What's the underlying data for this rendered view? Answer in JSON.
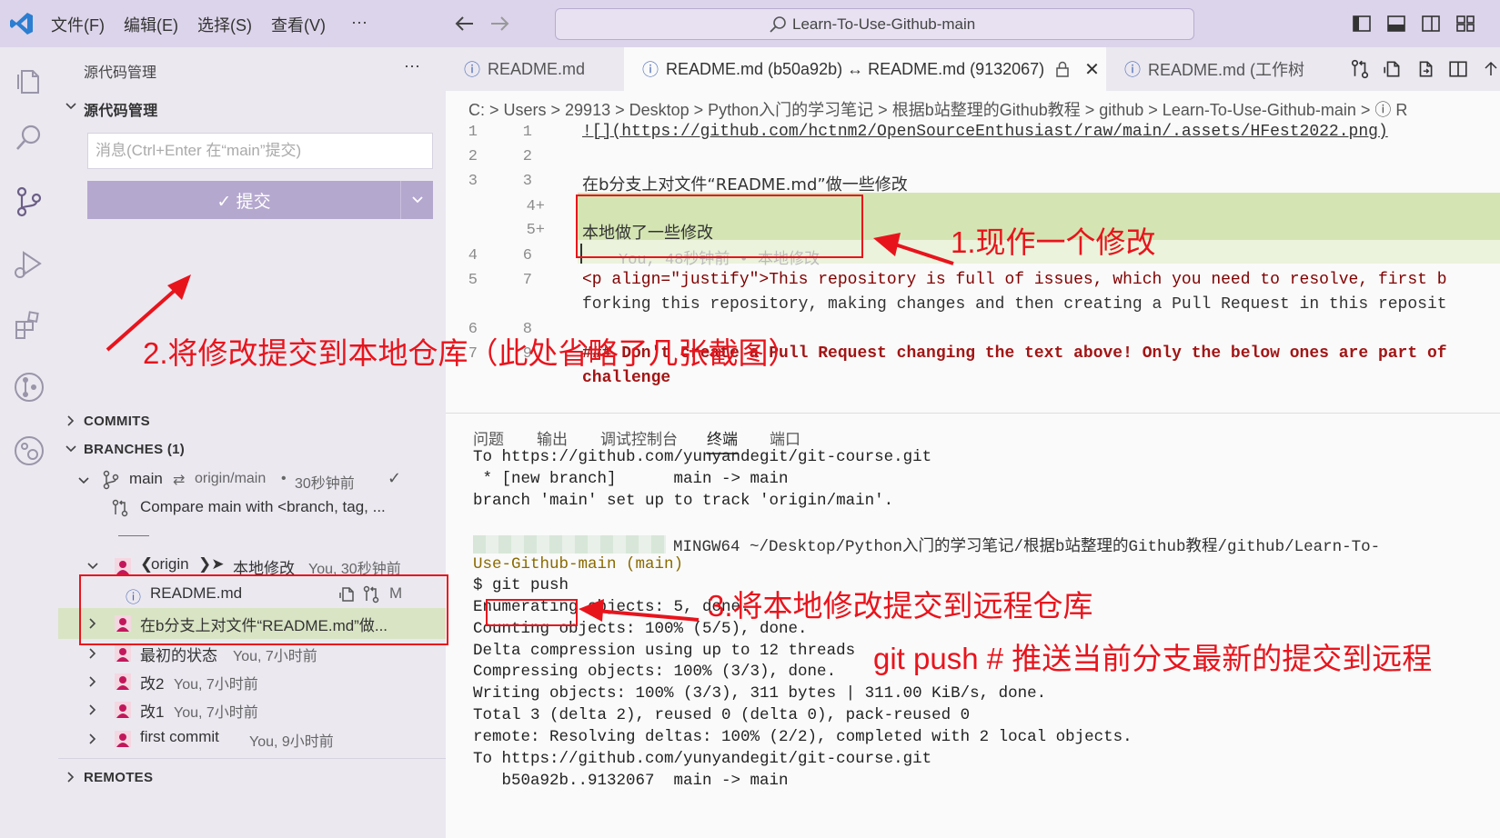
{
  "menu": {
    "file": "文件(F)",
    "edit": "编辑(E)",
    "select": "选择(S)",
    "view": "查看(V)",
    "more": "···"
  },
  "search": {
    "text": "Learn-To-Use-Github-main"
  },
  "sidebar": {
    "title": "源代码管理",
    "more": "···",
    "section": "源代码管理",
    "message_placeholder": "消息(Ctrl+Enter 在“main”提交)",
    "commit_label": "✓ 提交",
    "commits_header": "COMMITS",
    "branches_header": "BRANCHES (1)",
    "branch": {
      "name": "main",
      "remote": "origin/main",
      "time": "30秒钟前"
    },
    "compare": "Compare main with <branch, tag, ...",
    "commits": [
      {
        "message": "本地修改",
        "meta": "You, 30秒钟前",
        "tag": "origin"
      },
      {
        "message": "在b分支上对文件“README.md”做...",
        "meta": ""
      },
      {
        "message": "最初的状态",
        "meta": "You, 7小时前"
      },
      {
        "message": "改2",
        "meta": "You, 7小时前"
      },
      {
        "message": "改1",
        "meta": "You, 7小时前"
      },
      {
        "message": "first commit",
        "meta": "You, 9小时前"
      }
    ],
    "file": {
      "name": "README.md",
      "status": "M"
    },
    "remotes_header": "REMOTES"
  },
  "tabs": [
    {
      "label": "README.md"
    },
    {
      "label": "README.md (b50a92b) ↔ README.md (9132067)"
    },
    {
      "label": "README.md (工作树"
    }
  ],
  "breadcrumb": "C: > Users > 29913 > Desktop > Python入门的学习笔记 > 根据b站整理的Github教程 > github > Learn-To-Use-Github-main > ⓘ R",
  "editor": {
    "lines": [
      {
        "old": "1",
        "new": "1",
        "text": "![](https://github.com/hctnm2/OpenSourceEnthusiast/raw/main/.assets/HFest2022.png)"
      },
      {
        "old": "2",
        "new": "2",
        "text": ""
      },
      {
        "old": "3",
        "new": "3",
        "text": "在b分支上对文件“README.md”做一些修改"
      },
      {
        "old": "",
        "new": "4+",
        "text": ""
      },
      {
        "old": "",
        "new": "5+",
        "text": "本地做了一些修改"
      },
      {
        "old": "4",
        "new": "6",
        "text": ""
      },
      {
        "old": "5",
        "new": "7",
        "text": "<p align=\"justify\">This repository is full of issues, which you need to resolve, first b"
      },
      {
        "old": "",
        "new": "",
        "text": "forking this repository, making changes and then creating a Pull Request in this reposit"
      },
      {
        "old": "6",
        "new": "8",
        "text": ""
      },
      {
        "old": "7",
        "new": "9",
        "text": "### Don't create a Pull Request changing the text above! Only the below ones are part of"
      },
      {
        "old": "",
        "new": "",
        "text": "challenge"
      }
    ],
    "blame": "You, 48秒钟前 • 本地修改"
  },
  "panel": {
    "tabs": [
      "问题",
      "输出",
      "调试控制台",
      "终端",
      "端口"
    ],
    "terminal": [
      "To https://github.com/yunyandegit/git-course.git",
      " * [new branch]      main -> main",
      "branch 'main' set up to track 'origin/main'.",
      "",
      "MINGW64 ~/Desktop/Python入门的学习笔记/根据b站整理的Github教程/github/Learn-To-",
      "Use-Github-main (main)",
      "$ git push",
      "Enumerating objects: 5, done.",
      "Counting objects: 100% (5/5), done.",
      "Delta compression using up to 12 threads",
      "Compressing objects: 100% (3/3), done.",
      "Writing objects: 100% (3/3), 311 bytes | 311.00 KiB/s, done.",
      "Total 3 (delta 2), reused 0 (delta 0), pack-reused 0",
      "remote: Resolving deltas: 100% (2/2), completed with 2 local objects.",
      "To https://github.com/yunyandegit/git-course.git",
      "   b50a92b..9132067  main -> main"
    ]
  },
  "annotations": {
    "a1": "1.现作一个修改",
    "a2": "2.将修改提交到本地仓库（此处省略了几张截图）",
    "a3": "3.将本地修改提交到远程仓库",
    "a4": "git push  # 推送当前分支最新的提交到远程"
  },
  "colors": {
    "accent": "#b5a8cf",
    "annotation": "#e8141c",
    "added": "#d4e5b3"
  }
}
